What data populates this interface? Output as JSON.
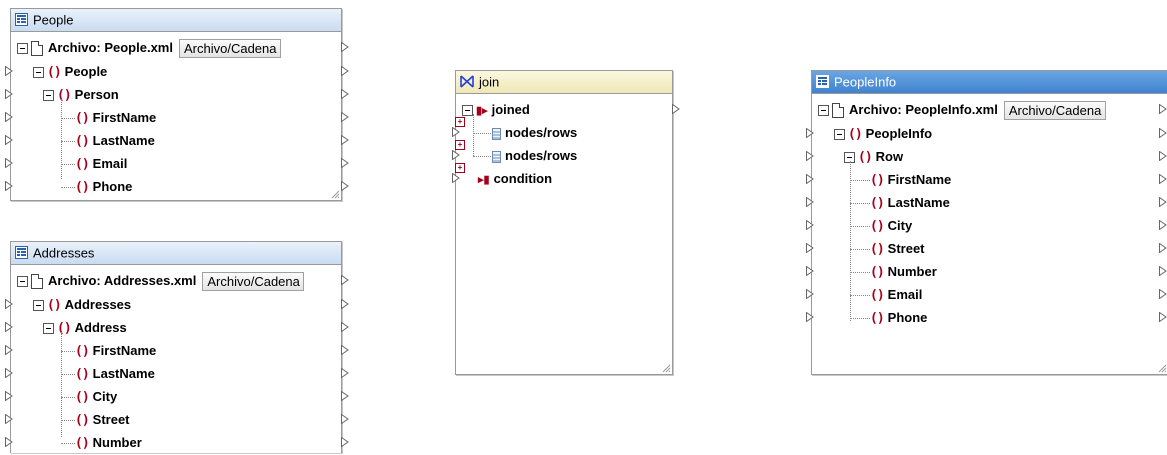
{
  "components": {
    "people": {
      "title": "People",
      "file_label": "Archivo: People.xml",
      "file_button": "Archivo/Cadena",
      "root": "People",
      "child": "Person",
      "fields": [
        "FirstName",
        "LastName",
        "Email",
        "Phone"
      ]
    },
    "addresses": {
      "title": "Addresses",
      "file_label": "Archivo: Addresses.xml",
      "file_button": "Archivo/Cadena",
      "root": "Addresses",
      "child": "Address",
      "fields": [
        "FirstName",
        "LastName",
        "City",
        "Street",
        "Number"
      ]
    },
    "join": {
      "title": "join",
      "joined": "joined",
      "inputs": [
        "nodes/rows",
        "nodes/rows"
      ],
      "condition": "condition"
    },
    "peopleinfo": {
      "title": "PeopleInfo",
      "file_label": "Archivo: PeopleInfo.xml",
      "file_button": "Archivo/Cadena",
      "root": "PeopleInfo",
      "child": "Row",
      "fields": [
        "FirstName",
        "LastName",
        "City",
        "Street",
        "Number",
        "Email",
        "Phone"
      ]
    }
  },
  "colors": {
    "title_blue_light": "#c9dcf1",
    "title_blue_selected": "#3f82cf",
    "title_join": "#efe7b6",
    "element_icon": "#a5001a"
  },
  "icons": {
    "component": "component-icon",
    "file": "file-icon",
    "element": "element-icon",
    "join": "join-icon",
    "connector": "connector-icon"
  }
}
